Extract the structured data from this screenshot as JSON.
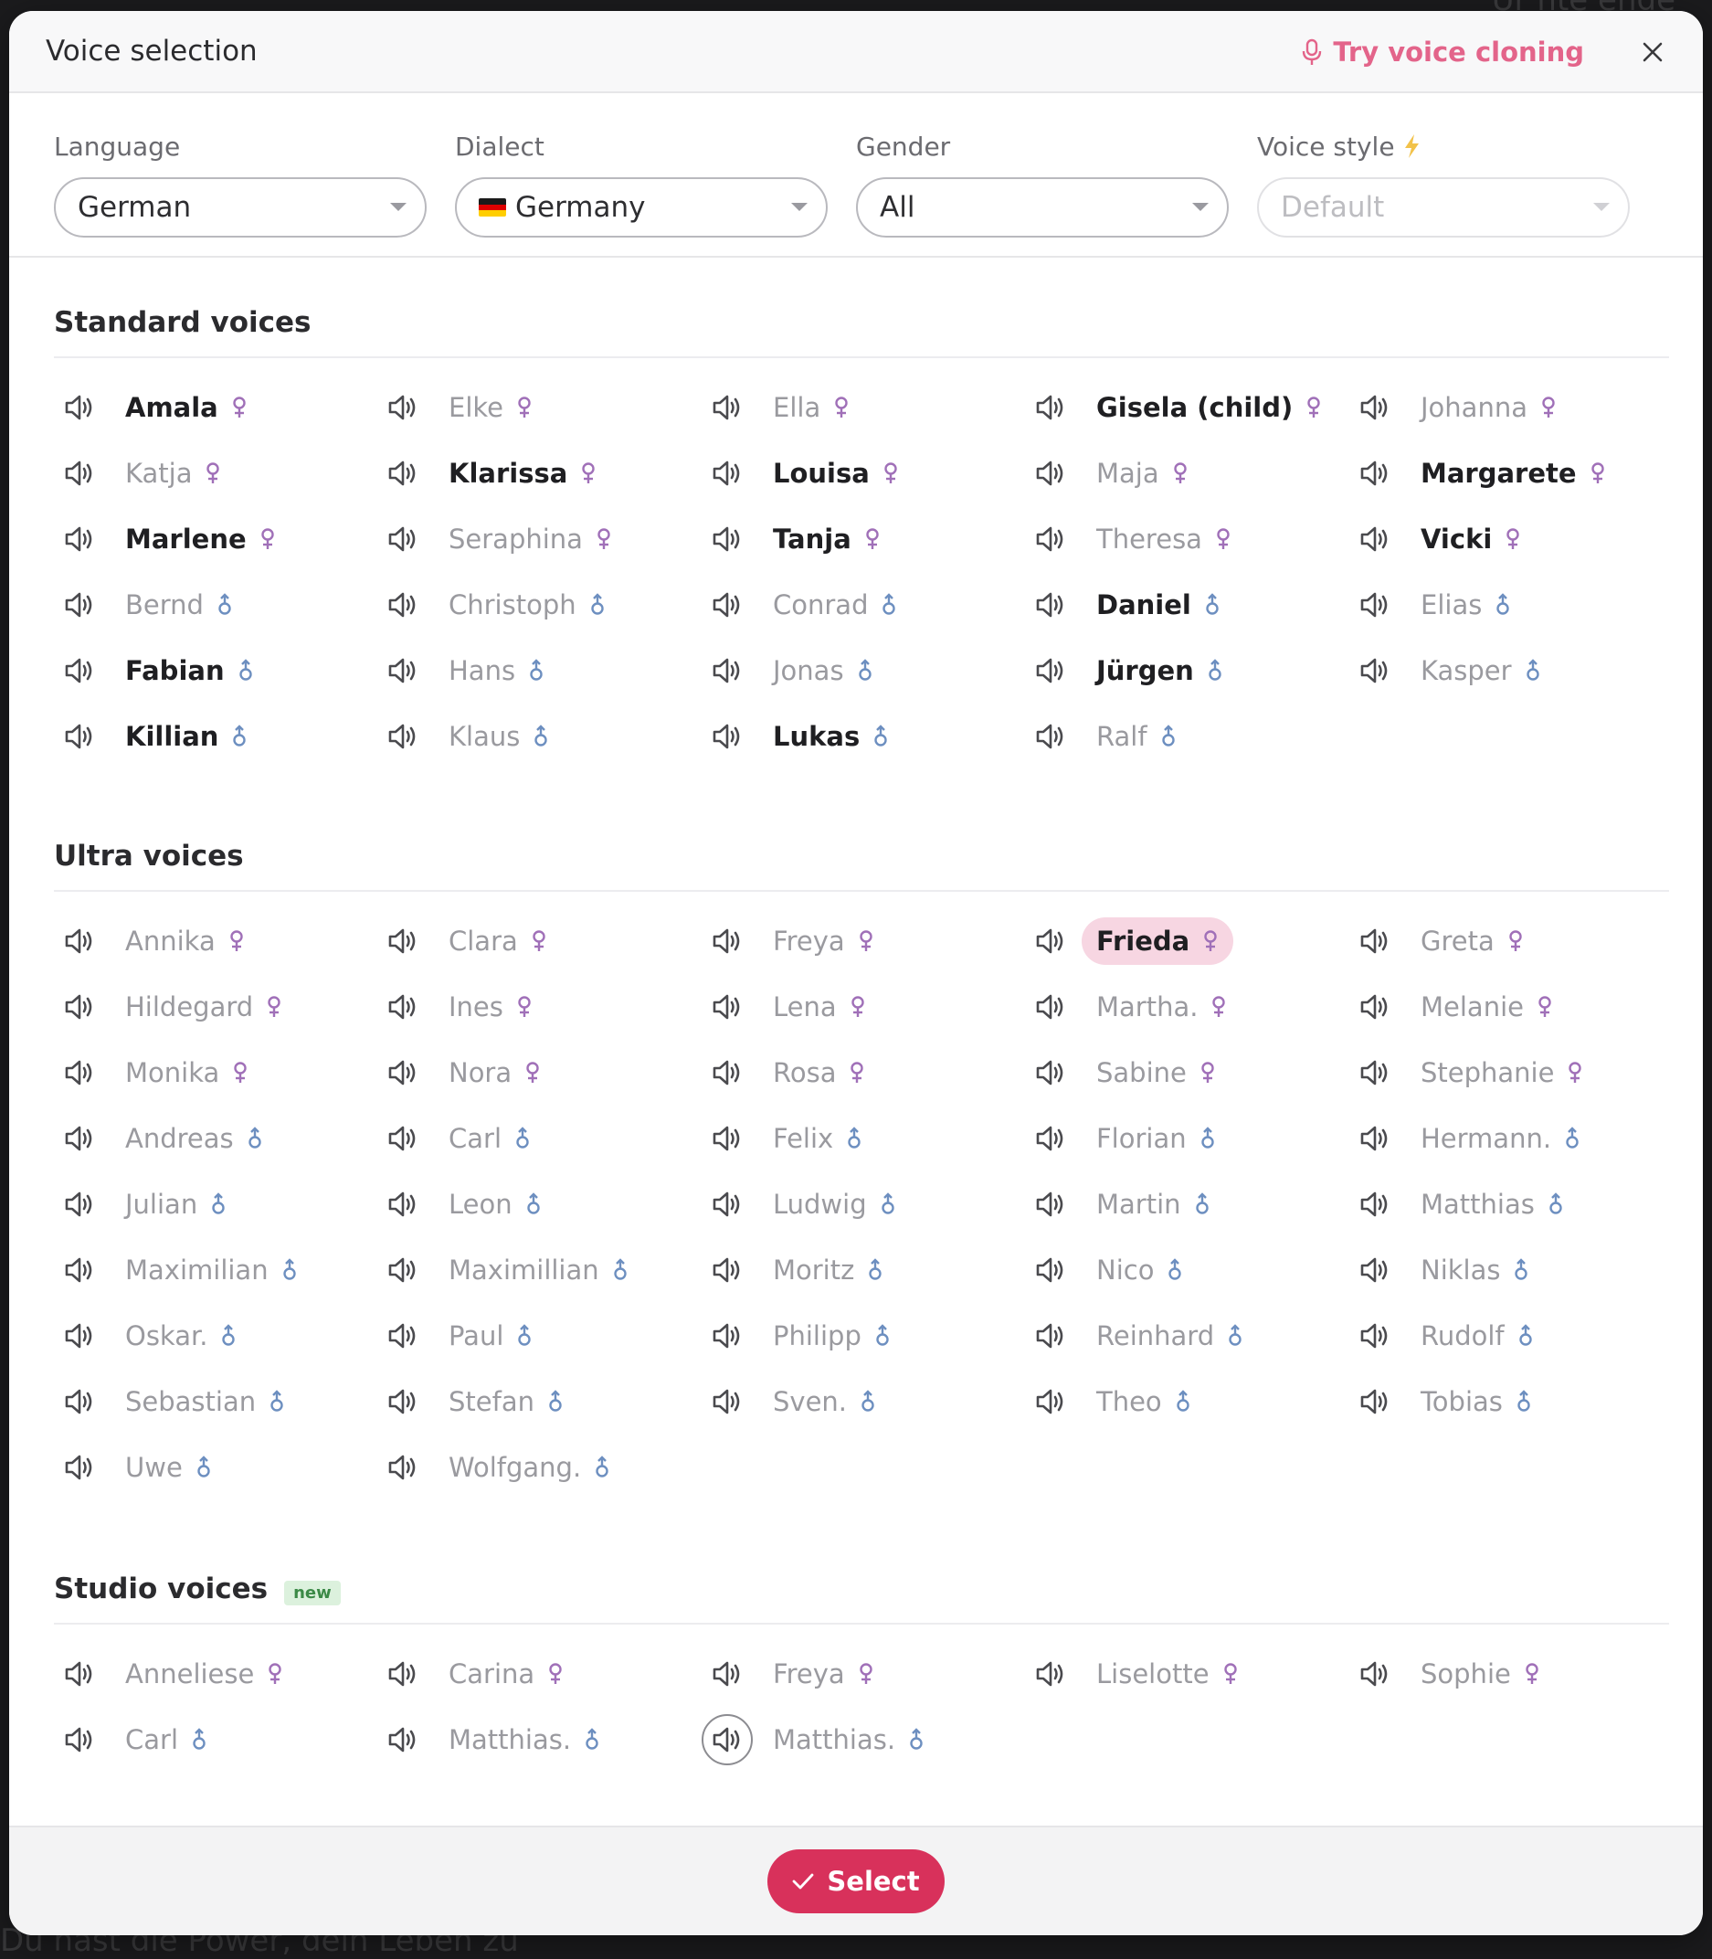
{
  "header": {
    "title": "Voice selection",
    "clone_label": "Try voice cloning"
  },
  "backdrop": {
    "top_right": "Ur nte ende",
    "bottom_left": "Du hast die Power, dein Leben zu"
  },
  "filters": {
    "language": {
      "label": "Language",
      "value": "German"
    },
    "dialect": {
      "label": "Dialect",
      "value": "Germany"
    },
    "gender": {
      "label": "Gender",
      "value": "All"
    },
    "voice_style": {
      "label": "Voice style",
      "placeholder": "Default"
    }
  },
  "colors": {
    "accent": "#d8315b",
    "clone_link": "#e3648a",
    "female_symbol": "#a070b8",
    "male_symbol": "#6d8fc0",
    "selected_bg": "#f7d6e2",
    "new_badge": "#dcf1dd"
  },
  "sections": [
    {
      "title": "Standard voices",
      "voices": [
        {
          "name": "Amala",
          "gender": "female",
          "bold": true
        },
        {
          "name": "Elke",
          "gender": "female",
          "bold": false
        },
        {
          "name": "Ella",
          "gender": "female",
          "bold": false
        },
        {
          "name": "Gisela (child)",
          "gender": "female",
          "bold": true
        },
        {
          "name": "Johanna",
          "gender": "female",
          "bold": false
        },
        {
          "name": "Katja",
          "gender": "female",
          "bold": false
        },
        {
          "name": "Klarissa",
          "gender": "female",
          "bold": true
        },
        {
          "name": "Louisa",
          "gender": "female",
          "bold": true
        },
        {
          "name": "Maja",
          "gender": "female",
          "bold": false
        },
        {
          "name": "Margarete",
          "gender": "female",
          "bold": true
        },
        {
          "name": "Marlene",
          "gender": "female",
          "bold": true
        },
        {
          "name": "Seraphina",
          "gender": "female",
          "bold": false
        },
        {
          "name": "Tanja",
          "gender": "female",
          "bold": true
        },
        {
          "name": "Theresa",
          "gender": "female",
          "bold": false
        },
        {
          "name": "Vicki",
          "gender": "female",
          "bold": true
        },
        {
          "name": "Bernd",
          "gender": "male",
          "bold": false
        },
        {
          "name": "Christoph",
          "gender": "male",
          "bold": false
        },
        {
          "name": "Conrad",
          "gender": "male",
          "bold": false
        },
        {
          "name": "Daniel",
          "gender": "male",
          "bold": true
        },
        {
          "name": "Elias",
          "gender": "male",
          "bold": false
        },
        {
          "name": "Fabian",
          "gender": "male",
          "bold": true
        },
        {
          "name": "Hans",
          "gender": "male",
          "bold": false
        },
        {
          "name": "Jonas",
          "gender": "male",
          "bold": false
        },
        {
          "name": "Jürgen",
          "gender": "male",
          "bold": true
        },
        {
          "name": "Kasper",
          "gender": "male",
          "bold": false
        },
        {
          "name": "Killian",
          "gender": "male",
          "bold": true
        },
        {
          "name": "Klaus",
          "gender": "male",
          "bold": false
        },
        {
          "name": "Lukas",
          "gender": "male",
          "bold": true
        },
        {
          "name": "Ralf",
          "gender": "male",
          "bold": false
        }
      ]
    },
    {
      "title": "Ultra voices",
      "voices": [
        {
          "name": "Annika",
          "gender": "female",
          "bold": false
        },
        {
          "name": "Clara",
          "gender": "female",
          "bold": false
        },
        {
          "name": "Freya",
          "gender": "female",
          "bold": false
        },
        {
          "name": "Frieda",
          "gender": "female",
          "bold": true,
          "selected": true
        },
        {
          "name": "Greta",
          "gender": "female",
          "bold": false
        },
        {
          "name": "Hildegard",
          "gender": "female",
          "bold": false
        },
        {
          "name": "Ines",
          "gender": "female",
          "bold": false
        },
        {
          "name": "Lena",
          "gender": "female",
          "bold": false
        },
        {
          "name": "Martha.",
          "gender": "female",
          "bold": false
        },
        {
          "name": "Melanie",
          "gender": "female",
          "bold": false
        },
        {
          "name": "Monika",
          "gender": "female",
          "bold": false
        },
        {
          "name": "Nora",
          "gender": "female",
          "bold": false
        },
        {
          "name": "Rosa",
          "gender": "female",
          "bold": false
        },
        {
          "name": "Sabine",
          "gender": "female",
          "bold": false
        },
        {
          "name": "Stephanie",
          "gender": "female",
          "bold": false
        },
        {
          "name": "Andreas",
          "gender": "male",
          "bold": false
        },
        {
          "name": "Carl",
          "gender": "male",
          "bold": false
        },
        {
          "name": "Felix",
          "gender": "male",
          "bold": false
        },
        {
          "name": "Florian",
          "gender": "male",
          "bold": false
        },
        {
          "name": "Hermann.",
          "gender": "male",
          "bold": false
        },
        {
          "name": "Julian",
          "gender": "male",
          "bold": false
        },
        {
          "name": "Leon",
          "gender": "male",
          "bold": false
        },
        {
          "name": "Ludwig",
          "gender": "male",
          "bold": false
        },
        {
          "name": "Martin",
          "gender": "male",
          "bold": false
        },
        {
          "name": "Matthias",
          "gender": "male",
          "bold": false
        },
        {
          "name": "Maximilian",
          "gender": "male",
          "bold": false
        },
        {
          "name": "Maximillian",
          "gender": "male",
          "bold": false
        },
        {
          "name": "Moritz",
          "gender": "male",
          "bold": false
        },
        {
          "name": "Nico",
          "gender": "male",
          "bold": false
        },
        {
          "name": "Niklas",
          "gender": "male",
          "bold": false
        },
        {
          "name": "Oskar.",
          "gender": "male",
          "bold": false
        },
        {
          "name": "Paul",
          "gender": "male",
          "bold": false
        },
        {
          "name": "Philipp",
          "gender": "male",
          "bold": false
        },
        {
          "name": "Reinhard",
          "gender": "male",
          "bold": false
        },
        {
          "name": "Rudolf",
          "gender": "male",
          "bold": false
        },
        {
          "name": "Sebastian",
          "gender": "male",
          "bold": false
        },
        {
          "name": "Stefan",
          "gender": "male",
          "bold": false
        },
        {
          "name": "Sven.",
          "gender": "male",
          "bold": false
        },
        {
          "name": "Theo",
          "gender": "male",
          "bold": false
        },
        {
          "name": "Tobias",
          "gender": "male",
          "bold": false
        },
        {
          "name": "Uwe",
          "gender": "male",
          "bold": false
        },
        {
          "name": "Wolfgang.",
          "gender": "male",
          "bold": false
        }
      ]
    },
    {
      "title": "Studio voices",
      "badge": "new",
      "voices": [
        {
          "name": "Anneliese",
          "gender": "female",
          "bold": false
        },
        {
          "name": "Carina",
          "gender": "female",
          "bold": false
        },
        {
          "name": "Freya",
          "gender": "female",
          "bold": false
        },
        {
          "name": "Liselotte",
          "gender": "female",
          "bold": false
        },
        {
          "name": "Sophie",
          "gender": "female",
          "bold": false
        },
        {
          "name": "Carl",
          "gender": "male",
          "bold": false
        },
        {
          "name": "Matthias.",
          "gender": "male",
          "bold": false
        },
        {
          "name": "Matthias.",
          "gender": "male",
          "bold": false,
          "focused": true
        }
      ]
    }
  ],
  "footer": {
    "select_label": "Select"
  }
}
